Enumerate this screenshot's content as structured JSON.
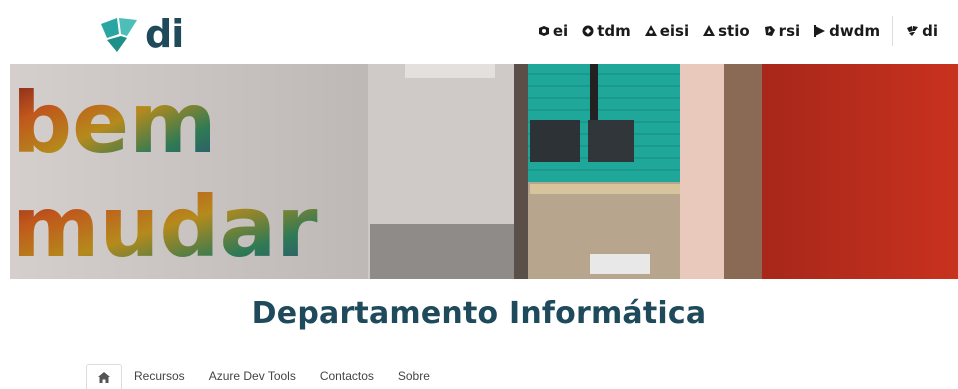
{
  "header": {
    "logo_text": "di",
    "logo_icon": "di-shield-icon",
    "sites": [
      {
        "label": "ei",
        "icon": "ei-icon"
      },
      {
        "label": "tdm",
        "icon": "tdm-icon"
      },
      {
        "label": "eisi",
        "icon": "eisi-icon"
      },
      {
        "label": "stio",
        "icon": "stio-icon"
      },
      {
        "label": "rsi",
        "icon": "rsi-icon"
      },
      {
        "label": "dwdm",
        "icon": "dwdm-icon"
      },
      {
        "label": "di",
        "icon": "di-icon"
      }
    ]
  },
  "hero": {
    "sign_line1": "bem",
    "sign_line2": "mudar"
  },
  "page": {
    "title": "Departamento Informática"
  },
  "nav": {
    "home_icon": "home-icon",
    "tabs": [
      "Recursos",
      "Azure Dev Tools",
      "Contactos",
      "Sobre"
    ]
  },
  "colors": {
    "brand_dark": "#1e4a5c",
    "brand_teal": "#2aa6a2",
    "red_wall": "#c8321e",
    "green_wall": "#1fa89a"
  }
}
